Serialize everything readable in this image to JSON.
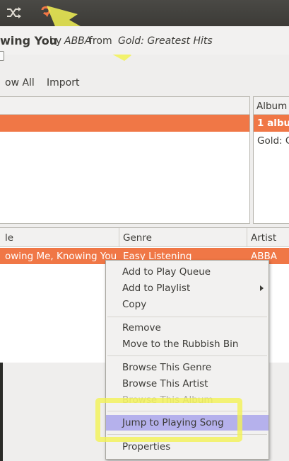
{
  "toolbar": {
    "shuffle_icon": "shuffle-icon",
    "repeat_icon": "repeat-icon"
  },
  "now_playing": {
    "title": "wing You",
    "by": "by",
    "artist": "ABBA",
    "from": "from",
    "album": "Gold: Greatest Hits"
  },
  "browser": {
    "show_all": "ow All",
    "import": "Import"
  },
  "album_pane": {
    "header": "Album",
    "selected": "1 albu",
    "row2": "Gold: C"
  },
  "songs": {
    "columns": {
      "title": "le",
      "genre": "Genre",
      "artist": "Artist"
    },
    "rows": [
      {
        "title": "owing Me, Knowing You",
        "genre": "Easy Listening",
        "artist": "ABBA"
      }
    ]
  },
  "context_menu": {
    "add_to_queue": "Add to Play Queue",
    "add_to_playlist": "Add to Playlist",
    "copy": "Copy",
    "remove": "Remove",
    "move_to_bin": "Move to the Rubbish Bin",
    "browse_genre": "Browse This Genre",
    "browse_artist": "Browse This Artist",
    "browse_album": "Browse This Album",
    "jump_to_playing": "Jump to Playing Song",
    "properties": "Properties"
  },
  "colors": {
    "selection": "#f07746",
    "menu_highlight": "#b5b1ec",
    "annotation": "#f2f255",
    "toolbar": "#3c3b37"
  }
}
